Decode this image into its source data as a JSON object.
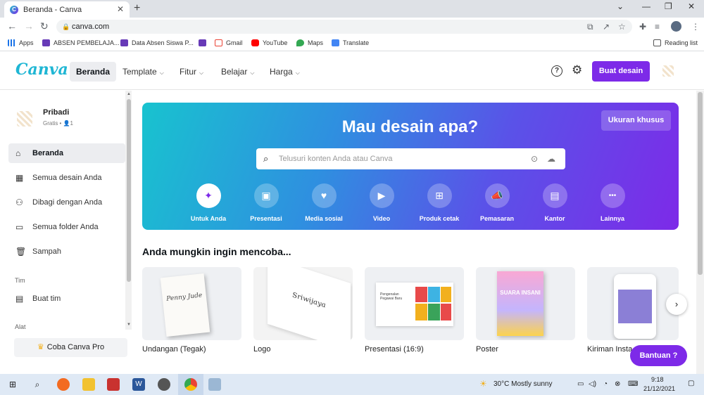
{
  "browser": {
    "tab_title": "Beranda - Canva",
    "tab_close": "✕",
    "new_tab": "+",
    "win_min": "⌄",
    "win_restore": "—",
    "win_max": "❐",
    "win_close": "✕",
    "url": "canva.com",
    "back": "←",
    "forward": "→",
    "reload": "↻"
  },
  "bookmarks": [
    {
      "label": "Apps",
      "color": "#1a73e8"
    },
    {
      "label": "ABSEN PEMBELAJA...",
      "color": "#673ab7"
    },
    {
      "label": "Data Absen Siswa P...",
      "color": "#673ab7"
    },
    {
      "label": "",
      "color": "#673ab7"
    },
    {
      "label": "Gmail",
      "color": "#ea4335"
    },
    {
      "label": "YouTube",
      "color": "#ff0000"
    },
    {
      "label": "Maps",
      "color": "#34a853"
    },
    {
      "label": "Translate",
      "color": "#4285f4"
    }
  ],
  "reading_list": "Reading list",
  "canva": {
    "logo": "Canva",
    "nav": [
      "Beranda",
      "Template",
      "Fitur",
      "Belajar",
      "Harga"
    ],
    "help": "?",
    "settings": "⚙",
    "create_button": "Buat desain"
  },
  "sidebar": {
    "profile_name": "Pribadi",
    "profile_sub": "Gratis • 👤1",
    "items": [
      "Beranda",
      "Semua desain Anda",
      "Dibagi dengan Anda",
      "Semua folder Anda",
      "Sampah"
    ],
    "section_team": "Tim",
    "team_items": [
      "Buat tim"
    ],
    "section_apps": "Alat",
    "pro_button": "Coba Canva Pro"
  },
  "hero": {
    "title": "Mau desain apa?",
    "custom_size": "Ukuran khusus",
    "search_placeholder": "Telusuri konten Anda atau Canva",
    "categories": [
      {
        "label": "Untuk Anda",
        "icon": "✦"
      },
      {
        "label": "Presentasi",
        "icon": "▣"
      },
      {
        "label": "Media sosial",
        "icon": "♥"
      },
      {
        "label": "Video",
        "icon": "▶"
      },
      {
        "label": "Produk cetak",
        "icon": "⊞"
      },
      {
        "label": "Pemasaran",
        "icon": "📣"
      },
      {
        "label": "Kantor",
        "icon": "▤"
      },
      {
        "label": "Lainnya",
        "icon": "•••"
      }
    ]
  },
  "suggestions": {
    "title": "Anda mungkin ingin mencoba...",
    "items": [
      {
        "label": "Undangan (Tegak)",
        "thumb_text": "Penny Jude"
      },
      {
        "label": "Logo",
        "thumb_text": "Sriwijaya"
      },
      {
        "label": "Presentasi (16:9)",
        "thumb_text": "Pengenalan Pegawai Baru"
      },
      {
        "label": "Poster",
        "thumb_text": "SUARA INSANI"
      },
      {
        "label": "Kiriman Insta",
        "thumb_text": ""
      }
    ],
    "next": "›"
  },
  "help_button": "Bantuan ?",
  "taskbar": {
    "weather": "30°C  Mostly sunny",
    "time": "9:18",
    "date": "21/12/2021"
  }
}
